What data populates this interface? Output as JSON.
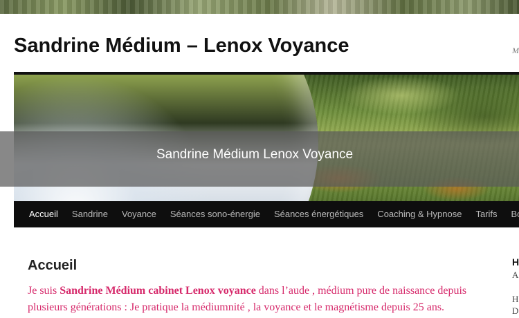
{
  "site": {
    "title": "Sandrine Médium – Lenox Voyance",
    "description_fragment": "M"
  },
  "banner": {
    "caption": "Sandrine Médium Lenox Voyance"
  },
  "nav": {
    "items": [
      {
        "label": "Accueil",
        "active": true
      },
      {
        "label": "Sandrine",
        "active": false
      },
      {
        "label": "Voyance",
        "active": false
      },
      {
        "label": "Séances sono-énergie",
        "active": false
      },
      {
        "label": "Séances énergétiques",
        "active": false
      },
      {
        "label": "Coaching & Hypnose",
        "active": false
      },
      {
        "label": "Tarifs",
        "active": false
      },
      {
        "label": "Bo",
        "active": false
      }
    ]
  },
  "main": {
    "heading": "Accueil",
    "intro_1": "Je suis ",
    "intro_bold": "Sandrine Médium cabinet Lenox voyance",
    "intro_2": " dans l’aude , médium pure de naissance depuis plusieurs générations : Je pratique la médiumnité , la voyance et le magnétisme depuis 25 ans."
  },
  "sidebar": {
    "heading_fragment": "H",
    "line_1_fragment": "A",
    "line_2_fragment": "H",
    "line_3_fragment": "D"
  },
  "colors": {
    "text_accent": "#d6286a",
    "nav_background": "#0e0e0e"
  }
}
